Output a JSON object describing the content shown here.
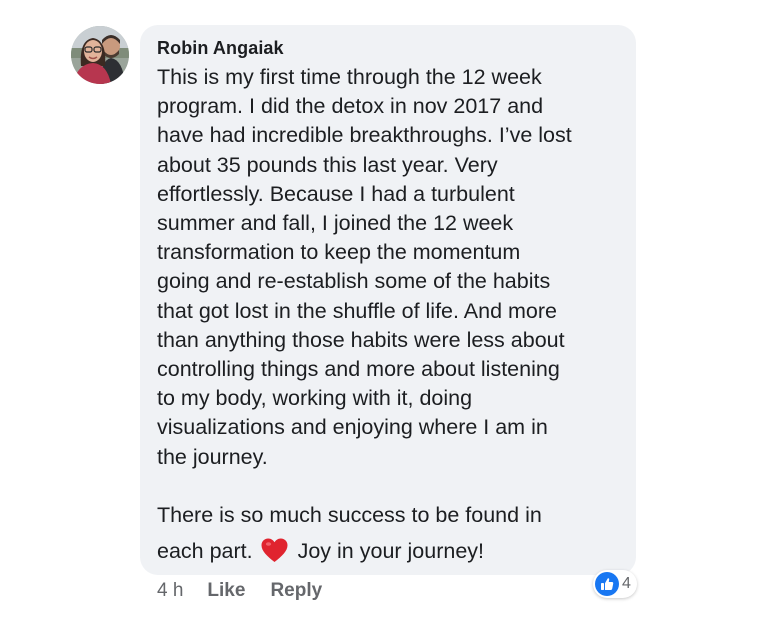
{
  "comment": {
    "author": "Robin Angaiak",
    "paragraph_1_lines": [
      "This is my first time through the 12 week",
      "program. I did the detox in nov 2017 and",
      "have had incredible breakthroughs. I’ve lost",
      "about 35 pounds this last year. Very",
      "effortlessly. Because I had a turbulent",
      "summer and fall, I joined the 12 week",
      "transformation to keep the momentum",
      "going and re-establish some of the habits",
      "that got lost in the shuffle of life. And more",
      "than anything those habits were less about",
      "controlling things and more about listening",
      "to my body, working with it, doing",
      "visualizations and enjoying where I am in",
      "the journey."
    ],
    "paragraph_2_line_1": "There is so much success to be found in",
    "paragraph_2_line_2_before": "each part.",
    "emoji": "red-heart",
    "paragraph_2_line_2_after": "Joy in your journey!"
  },
  "actions": {
    "timestamp": "4 h",
    "like_label": "Like",
    "reply_label": "Reply"
  },
  "reactions": {
    "icon": "thumbs-up-icon",
    "count": "4"
  },
  "colors": {
    "bubble": "#f0f2f5",
    "text": "#1c1e21",
    "secondary_text": "#65676b",
    "like_blue": "#1877f2",
    "heart_red": "#e0242f"
  }
}
